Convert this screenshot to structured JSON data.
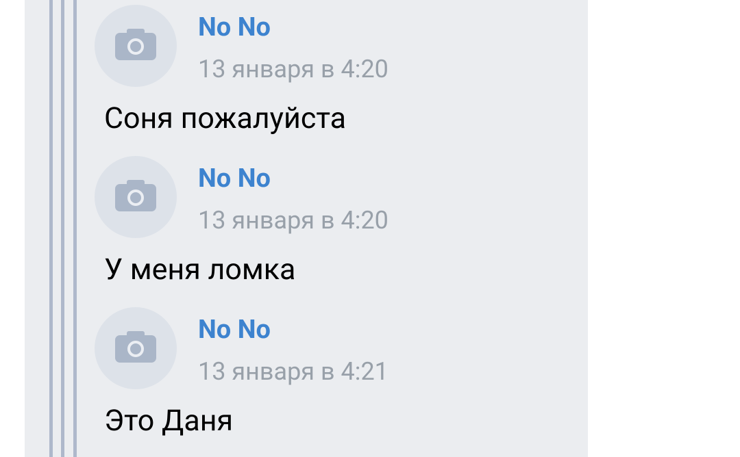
{
  "comments": [
    {
      "author": "No No",
      "date": "13 января в 4:20",
      "text": "Соня пожалуйста"
    },
    {
      "author": "No No",
      "date": "13 января в 4:20",
      "text": "У меня ломка"
    },
    {
      "author": "No No",
      "date": "13 января в 4:21",
      "text": "Это Даня"
    }
  ]
}
